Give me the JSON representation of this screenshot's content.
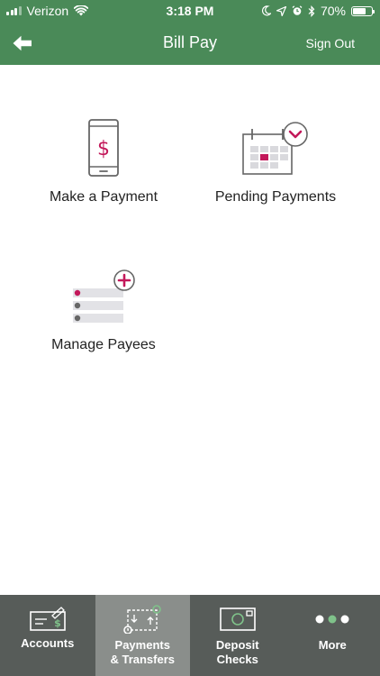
{
  "status_bar": {
    "carrier": "Verizon",
    "time": "3:18 PM",
    "battery_percent": "70%",
    "battery_level": 0.7,
    "icons": [
      "signal-icon",
      "wifi-icon",
      "moon-icon",
      "location-icon",
      "alarm-icon",
      "bluetooth-icon",
      "battery-icon"
    ]
  },
  "header": {
    "title": "Bill Pay",
    "back_icon": "arrow-left-icon",
    "sign_out_label": "Sign Out"
  },
  "tiles": [
    {
      "label": "Make a Payment",
      "icon": "phone-dollar-icon"
    },
    {
      "label": "Pending Payments",
      "icon": "calendar-pending-icon"
    },
    {
      "label": "Manage Payees",
      "icon": "payee-list-add-icon"
    }
  ],
  "tabbar": {
    "tabs": [
      {
        "label": "Accounts",
        "icon": "check-dollar-icon",
        "active": false
      },
      {
        "label": "Payments\n& Transfers",
        "icon": "transfer-icon",
        "active": true
      },
      {
        "label": "Deposit\nChecks",
        "icon": "deposit-check-icon",
        "active": false
      },
      {
        "label": "More",
        "icon": "more-dots-icon",
        "active": false
      }
    ]
  },
  "colors": {
    "header_green": "#4a8a58",
    "accent_magenta": "#c3185a",
    "tabbar_bg": "#575c59",
    "tab_active_bg": "#8a8e8b",
    "more_dot_green": "#7fc28a"
  }
}
